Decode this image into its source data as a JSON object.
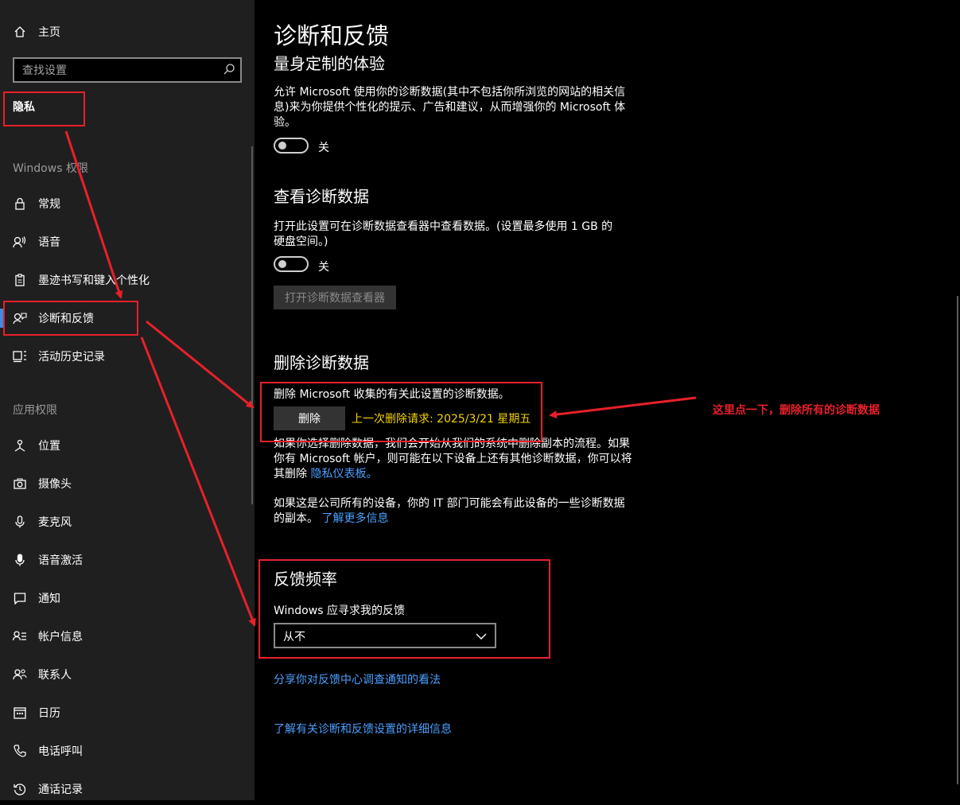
{
  "sidebar": {
    "home_label": "主页",
    "search_placeholder": "查找设置",
    "privacy_heading": "隐私",
    "group_windows": "Windows 权限",
    "group_apps": "应用权限",
    "items": [
      {
        "label": "常规",
        "icon": "lock-icon"
      },
      {
        "label": "语音",
        "icon": "speech-icon"
      },
      {
        "label": "墨迹书写和键入个性化",
        "icon": "clipboard-icon"
      },
      {
        "label": "诊断和反馈",
        "icon": "diagnostics-feedback-icon",
        "active": true
      },
      {
        "label": "活动历史记录",
        "icon": "activity-history-icon"
      },
      {
        "label": "位置",
        "icon": "location-icon"
      },
      {
        "label": "摄像头",
        "icon": "camera-icon"
      },
      {
        "label": "麦克风",
        "icon": "microphone-icon"
      },
      {
        "label": "语音激活",
        "icon": "voice-activation-icon"
      },
      {
        "label": "通知",
        "icon": "notification-icon"
      },
      {
        "label": "帐户信息",
        "icon": "account-info-icon"
      },
      {
        "label": "联系人",
        "icon": "contacts-icon"
      },
      {
        "label": "日历",
        "icon": "calendar-icon"
      },
      {
        "label": "电话呼叫",
        "icon": "phone-icon"
      },
      {
        "label": "通话记录",
        "icon": "call-history-icon"
      }
    ]
  },
  "main": {
    "title": "诊断和反馈",
    "tailored": {
      "heading": "量身定制的体验",
      "description": "允许 Microsoft 使用你的诊断数据(其中不包括你所浏览的网站的相关信息)来为你提供个性化的提示、广告和建议，从而增强你的 Microsoft 体验。",
      "toggle_state": "关"
    },
    "view": {
      "heading": "查看诊断数据",
      "description": "打开此设置可在诊断数据查看器中查看数据。(设置最多使用 1 GB 的硬盘空间。)",
      "toggle_state": "关",
      "button_label": "打开诊断数据查看器"
    },
    "delete": {
      "heading": "删除诊断数据",
      "description": "删除 Microsoft 收集的有关此设置的诊断数据。",
      "button_label": "删除",
      "last_request": "上一次删除请求: 2025/3/21 星期五",
      "info_1": "如果你选择删除数据，我们会开始从我们的系统中删除副本的流程。如果你有 Microsoft 帐户，则可能在以下设备上还有其他诊断数据，你可以将其删除",
      "privacy_dashboard_link": "隐私仪表板。",
      "info_2": "如果这是公司所有的设备，你的 IT 部门可能会有此设备的一些诊断数据的副本。",
      "learn_more_link": "了解更多信息"
    },
    "feedback": {
      "heading": "反馈频率",
      "select_label": "Windows 应寻求我的反馈",
      "select_value": "从不"
    },
    "share_link": "分享你对反馈中心调查通知的看法",
    "details_link": "了解有关诊断和反馈设置的详细信息"
  },
  "annotation": {
    "note": "这里点一下，删除所有的诊断数据",
    "color": "#e8202a"
  }
}
